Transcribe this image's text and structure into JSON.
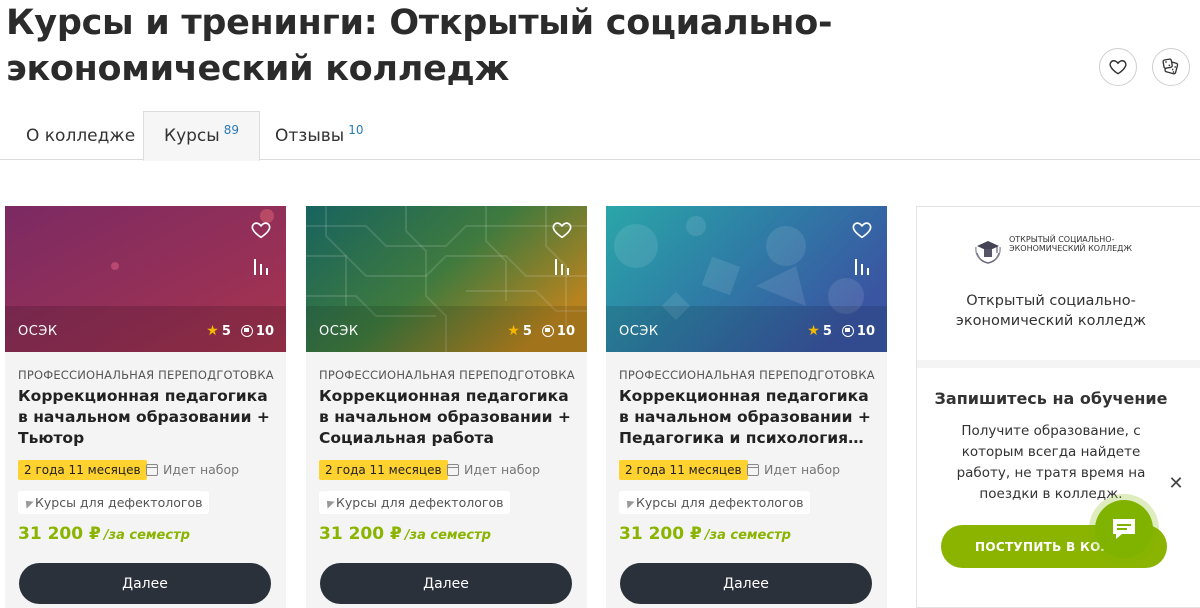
{
  "page": {
    "title": "Курсы и тренинги: Открытый социально-экономический колледж"
  },
  "tabs": [
    {
      "label": "О колледже",
      "count": ""
    },
    {
      "label": "Курсы",
      "count": "89"
    },
    {
      "label": "Отзывы",
      "count": "10"
    }
  ],
  "icons": {
    "favorite": "heart-icon",
    "random": "dice-icon",
    "compare": "bar-chart-icon",
    "chat": "chat-icon",
    "close": "close-icon"
  },
  "colors": {
    "accent_green": "#8ab400",
    "duration_badge": "#ffd230",
    "button_dark": "#2a313a",
    "count_blue": "#2a7ab8"
  },
  "courses": [
    {
      "org": "ОСЭК",
      "rating": "5",
      "reviews": "10",
      "type": "ПРОФЕССИОНАЛЬНАЯ ПЕРЕПОДГОТОВКА",
      "name": "Коррекционная педагогика в начальном образовании + Тьютор",
      "duration": "2 года 11 месяцев",
      "status": "Идет набор",
      "tag": "Курсы для дефектологов",
      "price": "31 200 ₽",
      "price_per": "/за семестр",
      "button": "Далее"
    },
    {
      "org": "ОСЭК",
      "rating": "5",
      "reviews": "10",
      "type": "ПРОФЕССИОНАЛЬНАЯ ПЕРЕПОДГОТОВКА",
      "name": "Коррекционная педагогика в начальном образовании + Социальная работа",
      "duration": "2 года 11 месяцев",
      "status": "Идет набор",
      "tag": "Курсы для дефектологов",
      "price": "31 200 ₽",
      "price_per": "/за семестр",
      "button": "Далее"
    },
    {
      "org": "ОСЭК",
      "rating": "5",
      "reviews": "10",
      "type": "ПРОФЕССИОНАЛЬНАЯ ПЕРЕПОДГОТОВКА",
      "name": "Коррекционная педагогика в начальном образовании + Педагогика и психология…",
      "duration": "2 года 11 месяцев",
      "status": "Идет набор",
      "tag": "Курсы для дефектологов",
      "price": "31 200 ₽",
      "price_per": "/за семестр",
      "button": "Далее"
    }
  ],
  "sidebar": {
    "logo_text": "Открытый социально-экономический колледж",
    "name": "Открытый социально-экономический колледж",
    "cta_title": "Запишитесь на обучение",
    "cta_text": "Получите образование, с которым всегда найдете работу, не тратя время на поездки в колледж.",
    "apply_label": "ПОСТУПИТЬ В КОЛЛ"
  }
}
